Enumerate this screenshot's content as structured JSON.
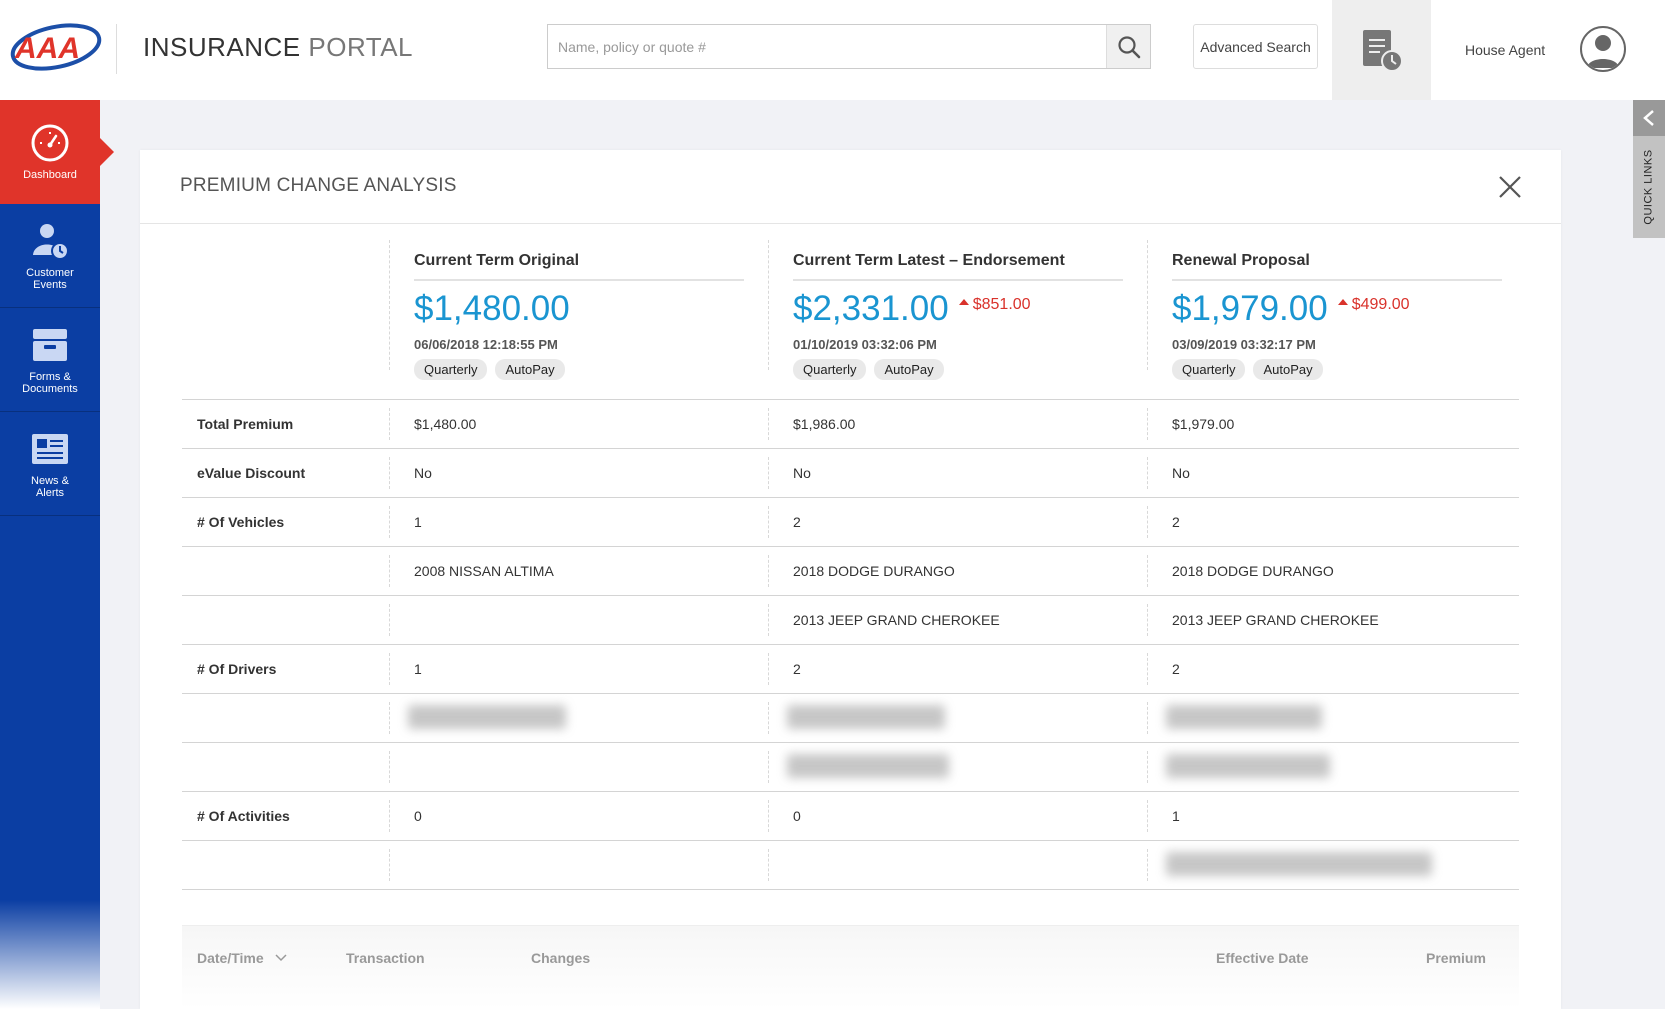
{
  "header": {
    "brand": "AAA",
    "title_strong": "INSURANCE",
    "title_light": "PORTAL",
    "search_placeholder": "Name, policy or quote #",
    "advanced_search": "Advanced Search",
    "user_name": "House Agent"
  },
  "sidebar": {
    "items": [
      {
        "label": "Dashboard",
        "icon": "gauge-icon",
        "active": true
      },
      {
        "label": "Customer Events",
        "icon": "user-clock-icon"
      },
      {
        "label": "Forms & Documents",
        "icon": "archive-box-icon"
      },
      {
        "label": "News & Alerts",
        "icon": "newspaper-icon"
      }
    ]
  },
  "quick_links": {
    "label": "QUICK LINKS"
  },
  "panel": {
    "title": "PREMIUM CHANGE ANALYSIS",
    "columns": [
      {
        "title": "Current Term Original",
        "price": "$1,480.00",
        "delta": "",
        "timestamp": "06/06/2018 12:18:55 PM",
        "pills": [
          "Quarterly",
          "AutoPay"
        ]
      },
      {
        "title": "Current Term Latest – Endorsement",
        "price": "$2,331.00",
        "delta": "$851.00",
        "timestamp": "01/10/2019 03:32:06 PM",
        "pills": [
          "Quarterly",
          "AutoPay"
        ]
      },
      {
        "title": "Renewal Proposal",
        "price": "$1,979.00",
        "delta": "$499.00",
        "timestamp": "03/09/2019  03:32:17 PM",
        "pills": [
          "Quarterly",
          "AutoPay"
        ]
      }
    ],
    "rows": [
      {
        "label": "Total Premium",
        "values": [
          "$1,480.00",
          "$1,986.00",
          "$1,979.00"
        ]
      },
      {
        "label": "eValue Discount",
        "values": [
          "No",
          "No",
          "No"
        ]
      },
      {
        "label": "# Of Vehicles",
        "values": [
          "1",
          "2",
          "2"
        ]
      },
      {
        "label": "",
        "values": [
          "2008 NISSAN ALTIMA",
          "2018 DODGE DURANGO",
          "2018 DODGE DURANGO"
        ]
      },
      {
        "label": "",
        "values": [
          "",
          "2013 JEEP GRAND CHEROKEE",
          "2013 JEEP GRAND CHEROKEE"
        ]
      },
      {
        "label": "# Of Drivers",
        "values": [
          "1",
          "2",
          "2"
        ]
      },
      {
        "label": "",
        "values": [
          "",
          "",
          ""
        ]
      },
      {
        "label": "",
        "values": [
          "",
          "",
          ""
        ]
      },
      {
        "label": "# Of Activities",
        "values": [
          "0",
          "0",
          "1"
        ]
      },
      {
        "label": "",
        "values": [
          "",
          "",
          ""
        ]
      }
    ],
    "transactions_header": {
      "date_time": "Date/Time",
      "transaction": "Transaction",
      "changes": "Changes",
      "effective_date": "Effective Date",
      "premium": "Premium"
    }
  },
  "colors": {
    "brand_red": "#e0342a",
    "sidebar_blue": "#0b3ea3",
    "price_blue": "#1a95d1",
    "delta_red": "#d9322b"
  }
}
